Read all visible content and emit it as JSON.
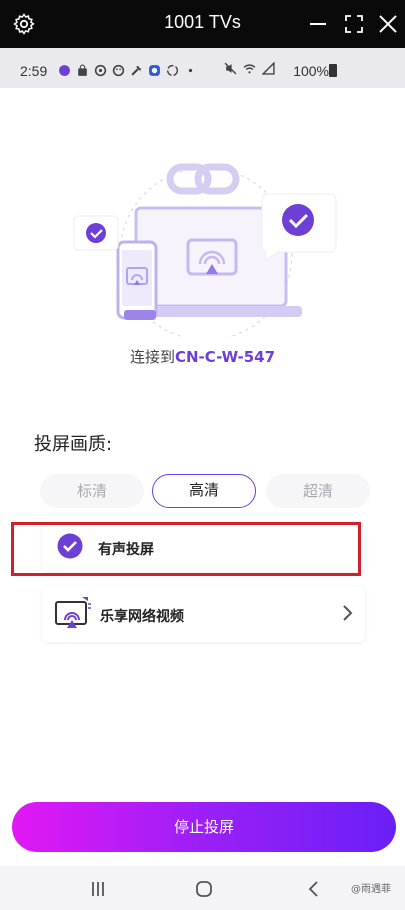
{
  "window": {
    "title": "1001 TVs"
  },
  "status_bar": {
    "time": "2:59",
    "battery": "100%"
  },
  "connection": {
    "prefix": "连接到",
    "device": "CN-C-W-547"
  },
  "quality": {
    "label": "投屏画质:",
    "options": [
      "标清",
      "高清",
      "超清"
    ],
    "selected": "高清"
  },
  "options_list": [
    {
      "label": "有声投屏",
      "checked": true
    },
    {
      "label": "乐享网络视频"
    }
  ],
  "stop_button": {
    "label": "停止投屏"
  },
  "watermark": "@雨遇菲",
  "colors": {
    "accent": "#6d3fd6",
    "highlight_border": "#d21f2d",
    "button_gradient_start": "#e218f4",
    "button_gradient_end": "#6a1ff7",
    "titlebar_bg": "#0a0a0a"
  },
  "icons": {
    "settings": "gear-icon",
    "minimize": "minimize-icon",
    "maximize": "maximize-icon",
    "close": "close-icon",
    "check": "check-icon",
    "cast_video": "cast-video-icon",
    "chevron": "chevron-right-icon",
    "nav_recent": "recent-apps-icon",
    "nav_home": "home-icon",
    "nav_back": "back-icon"
  }
}
